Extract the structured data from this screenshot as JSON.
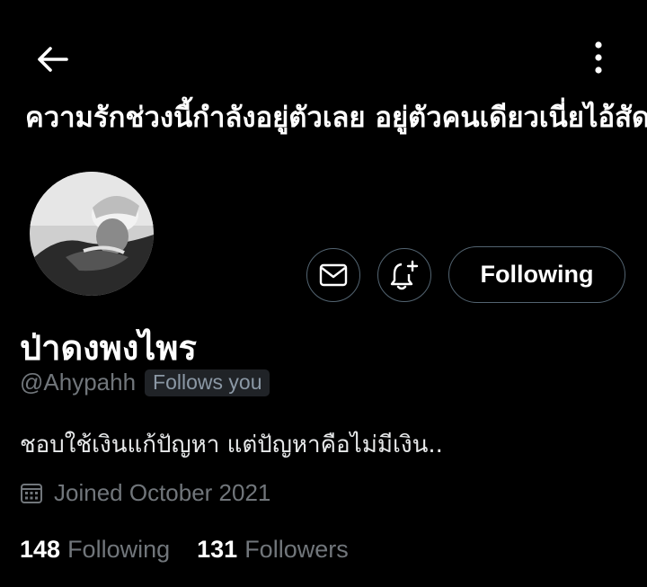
{
  "header": {
    "back_icon": "arrow-left-icon",
    "more_icon": "vertical-ellipsis-icon"
  },
  "banner": {
    "text": "ความรักช่วงนี้กำลังอยู่ตัวเลย อยู่ตัวคนเดียวเนี่ยไอ้สัด"
  },
  "actions": {
    "message_icon": "envelope-icon",
    "notify_icon": "bell-plus-icon",
    "following_label": "Following"
  },
  "profile": {
    "display_name": "ป่าดงพงไพร",
    "handle": "@Ahypahh",
    "follows_you": "Follows you",
    "bio": "ชอบใช้เงินแก้ปัญหา แต่ปัญหาคือไม่มีเงิน..",
    "joined": "Joined October 2021",
    "calendar_icon": "calendar-icon"
  },
  "stats": {
    "following_count": "148",
    "following_label": "Following",
    "followers_count": "131",
    "followers_label": "Followers"
  },
  "colors": {
    "background": "#000000",
    "text_primary": "#e7e9ea",
    "text_secondary": "#71767b",
    "border": "#536471",
    "badge_bg": "#202327"
  }
}
